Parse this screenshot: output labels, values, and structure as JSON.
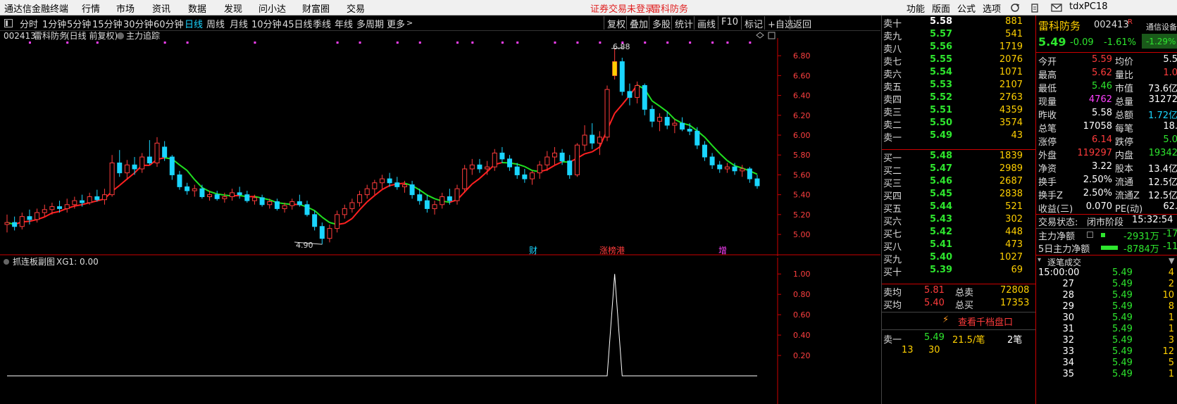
{
  "menubar": {
    "app_title": "通达信金融终端",
    "items": [
      "行情",
      "市场",
      "资讯",
      "数据",
      "发现",
      "问小达",
      "财富圈",
      "交易"
    ],
    "warning": "证券交易未登录",
    "stock_link": "雷科防务",
    "right_items": [
      "功能",
      "版面",
      "公式",
      "选项"
    ],
    "user": "tdxPC18"
  },
  "toolbar": {
    "periods": [
      "分时",
      "1分钟",
      "5分钟",
      "15分钟",
      "30分钟",
      "60分钟",
      "日线",
      "周线",
      "月线",
      "10分钟",
      "45日线",
      "季线",
      "年线",
      "多周期",
      "更多"
    ],
    "active_period": "日线",
    "right_buttons": [
      "复权",
      "叠加",
      "多股",
      "统计",
      "画线",
      "F10",
      "标记",
      "+自选",
      "返回"
    ]
  },
  "main_chart": {
    "header_code": "002413",
    "header_name": "雷科防务",
    "header_mode": "(日线 前复权)",
    "indicator": "主力追踪",
    "high_label": "6.88",
    "low_label": "4.90",
    "y_ticks": [
      "6.80",
      "6.60",
      "6.40",
      "6.20",
      "6.00",
      "5.80",
      "5.60",
      "5.40",
      "5.20",
      "5.00"
    ],
    "event_markers": [
      "财",
      "涨榜港",
      "增"
    ]
  },
  "sub_chart": {
    "title": "抓连板副图",
    "value_label": "XG1: 0.00",
    "y_ticks": [
      "1.00",
      "0.80",
      "0.60",
      "0.40",
      "0.20"
    ]
  },
  "chart_data": {
    "type": "candlestick",
    "title": "002413 雷科防务 (日线 前复权)",
    "ylim": [
      4.88,
      6.95
    ],
    "candles": [
      {
        "o": 5.1,
        "h": 5.2,
        "l": 5.02,
        "c": 5.12
      },
      {
        "o": 5.12,
        "h": 5.18,
        "l": 5.04,
        "c": 5.08
      },
      {
        "o": 5.08,
        "h": 5.22,
        "l": 5.05,
        "c": 5.18
      },
      {
        "o": 5.18,
        "h": 5.25,
        "l": 5.1,
        "c": 5.15
      },
      {
        "o": 5.15,
        "h": 5.26,
        "l": 5.12,
        "c": 5.22
      },
      {
        "o": 5.22,
        "h": 5.3,
        "l": 5.18,
        "c": 5.25
      },
      {
        "o": 5.25,
        "h": 5.32,
        "l": 5.2,
        "c": 5.28
      },
      {
        "o": 5.28,
        "h": 5.34,
        "l": 5.22,
        "c": 5.26
      },
      {
        "o": 5.26,
        "h": 5.36,
        "l": 5.22,
        "c": 5.3
      },
      {
        "o": 5.3,
        "h": 5.38,
        "l": 5.26,
        "c": 5.34
      },
      {
        "o": 5.34,
        "h": 5.4,
        "l": 5.28,
        "c": 5.32
      },
      {
        "o": 5.32,
        "h": 5.42,
        "l": 5.3,
        "c": 5.38
      },
      {
        "o": 5.38,
        "h": 5.45,
        "l": 5.33,
        "c": 5.35
      },
      {
        "o": 5.35,
        "h": 5.46,
        "l": 5.3,
        "c": 5.4
      },
      {
        "o": 5.4,
        "h": 5.8,
        "l": 5.38,
        "c": 5.72
      },
      {
        "o": 5.72,
        "h": 5.85,
        "l": 5.58,
        "c": 5.62
      },
      {
        "o": 5.62,
        "h": 5.75,
        "l": 5.55,
        "c": 5.7
      },
      {
        "o": 5.7,
        "h": 5.78,
        "l": 5.6,
        "c": 5.66
      },
      {
        "o": 5.66,
        "h": 5.82,
        "l": 5.62,
        "c": 5.78
      },
      {
        "o": 5.78,
        "h": 5.95,
        "l": 5.7,
        "c": 5.72
      },
      {
        "o": 5.72,
        "h": 5.98,
        "l": 5.68,
        "c": 5.92
      },
      {
        "o": 5.88,
        "h": 5.94,
        "l": 5.74,
        "c": 5.78
      },
      {
        "o": 5.78,
        "h": 5.8,
        "l": 5.55,
        "c": 5.6
      },
      {
        "o": 5.6,
        "h": 5.64,
        "l": 5.45,
        "c": 5.48
      },
      {
        "o": 5.48,
        "h": 5.52,
        "l": 5.4,
        "c": 5.44
      },
      {
        "o": 5.44,
        "h": 5.5,
        "l": 5.38,
        "c": 5.46
      },
      {
        "o": 5.46,
        "h": 5.5,
        "l": 5.36,
        "c": 5.38
      },
      {
        "o": 5.38,
        "h": 5.44,
        "l": 5.34,
        "c": 5.4
      },
      {
        "o": 5.4,
        "h": 5.44,
        "l": 5.34,
        "c": 5.36
      },
      {
        "o": 5.36,
        "h": 5.42,
        "l": 5.32,
        "c": 5.38
      },
      {
        "o": 5.38,
        "h": 5.46,
        "l": 5.34,
        "c": 5.42
      },
      {
        "o": 5.42,
        "h": 5.48,
        "l": 5.36,
        "c": 5.4
      },
      {
        "o": 5.4,
        "h": 5.44,
        "l": 5.32,
        "c": 5.34
      },
      {
        "o": 5.34,
        "h": 5.4,
        "l": 5.3,
        "c": 5.37
      },
      {
        "o": 5.37,
        "h": 5.4,
        "l": 5.28,
        "c": 5.3
      },
      {
        "o": 5.3,
        "h": 5.36,
        "l": 5.26,
        "c": 5.33
      },
      {
        "o": 5.33,
        "h": 5.36,
        "l": 5.24,
        "c": 5.26
      },
      {
        "o": 5.26,
        "h": 5.32,
        "l": 5.22,
        "c": 5.29
      },
      {
        "o": 5.29,
        "h": 5.36,
        "l": 5.25,
        "c": 5.33
      },
      {
        "o": 5.33,
        "h": 5.4,
        "l": 5.28,
        "c": 5.3
      },
      {
        "o": 5.3,
        "h": 5.34,
        "l": 5.18,
        "c": 5.2
      },
      {
        "o": 5.2,
        "h": 5.24,
        "l": 5.04,
        "c": 5.08
      },
      {
        "o": 5.08,
        "h": 5.12,
        "l": 4.9,
        "c": 4.96
      },
      {
        "o": 4.96,
        "h": 5.1,
        "l": 4.92,
        "c": 5.06
      },
      {
        "o": 5.06,
        "h": 5.24,
        "l": 5.02,
        "c": 5.2
      },
      {
        "o": 5.2,
        "h": 5.3,
        "l": 5.16,
        "c": 5.26
      },
      {
        "o": 5.26,
        "h": 5.36,
        "l": 5.22,
        "c": 5.32
      },
      {
        "o": 5.32,
        "h": 5.44,
        "l": 5.28,
        "c": 5.4
      },
      {
        "o": 5.4,
        "h": 5.5,
        "l": 5.36,
        "c": 5.46
      },
      {
        "o": 5.46,
        "h": 5.55,
        "l": 5.4,
        "c": 5.52
      },
      {
        "o": 5.52,
        "h": 5.6,
        "l": 5.46,
        "c": 5.56
      },
      {
        "o": 5.56,
        "h": 5.62,
        "l": 5.48,
        "c": 5.52
      },
      {
        "o": 5.52,
        "h": 5.58,
        "l": 5.45,
        "c": 5.48
      },
      {
        "o": 5.48,
        "h": 5.54,
        "l": 5.42,
        "c": 5.5
      },
      {
        "o": 5.5,
        "h": 5.54,
        "l": 5.36,
        "c": 5.4
      },
      {
        "o": 5.4,
        "h": 5.46,
        "l": 5.3,
        "c": 5.34
      },
      {
        "o": 5.34,
        "h": 5.4,
        "l": 5.22,
        "c": 5.26
      },
      {
        "o": 5.26,
        "h": 5.34,
        "l": 5.2,
        "c": 5.3
      },
      {
        "o": 5.3,
        "h": 5.42,
        "l": 5.26,
        "c": 5.38
      },
      {
        "o": 5.38,
        "h": 5.46,
        "l": 5.3,
        "c": 5.34
      },
      {
        "o": 5.34,
        "h": 5.5,
        "l": 5.3,
        "c": 5.46
      },
      {
        "o": 5.46,
        "h": 5.7,
        "l": 5.42,
        "c": 5.66
      },
      {
        "o": 5.66,
        "h": 5.76,
        "l": 5.6,
        "c": 5.7
      },
      {
        "o": 5.7,
        "h": 5.76,
        "l": 5.62,
        "c": 5.66
      },
      {
        "o": 5.66,
        "h": 5.74,
        "l": 5.6,
        "c": 5.68
      },
      {
        "o": 5.68,
        "h": 5.86,
        "l": 5.64,
        "c": 5.82
      },
      {
        "o": 5.82,
        "h": 5.88,
        "l": 5.72,
        "c": 5.76
      },
      {
        "o": 5.76,
        "h": 5.8,
        "l": 5.64,
        "c": 5.68
      },
      {
        "o": 5.68,
        "h": 5.72,
        "l": 5.56,
        "c": 5.6
      },
      {
        "o": 5.6,
        "h": 5.66,
        "l": 5.52,
        "c": 5.56
      },
      {
        "o": 5.56,
        "h": 5.64,
        "l": 5.5,
        "c": 5.62
      },
      {
        "o": 5.62,
        "h": 5.74,
        "l": 5.56,
        "c": 5.7
      },
      {
        "o": 5.7,
        "h": 5.84,
        "l": 5.64,
        "c": 5.78
      },
      {
        "o": 5.78,
        "h": 5.88,
        "l": 5.7,
        "c": 5.82
      },
      {
        "o": 5.82,
        "h": 5.86,
        "l": 5.7,
        "c": 5.74
      },
      {
        "o": 5.74,
        "h": 5.8,
        "l": 5.56,
        "c": 5.6
      },
      {
        "o": 5.6,
        "h": 5.92,
        "l": 5.58,
        "c": 5.9
      },
      {
        "o": 5.9,
        "h": 6.1,
        "l": 5.84,
        "c": 6.0
      },
      {
        "o": 6.0,
        "h": 6.12,
        "l": 5.86,
        "c": 5.92
      },
      {
        "o": 5.92,
        "h": 6.04,
        "l": 5.8,
        "c": 5.98
      },
      {
        "o": 5.98,
        "h": 6.5,
        "l": 5.94,
        "c": 6.46
      },
      {
        "o": 6.6,
        "h": 6.88,
        "l": 6.56,
        "c": 6.74
      },
      {
        "o": 6.74,
        "h": 6.78,
        "l": 6.4,
        "c": 6.44
      },
      {
        "o": 6.44,
        "h": 6.52,
        "l": 6.3,
        "c": 6.38
      },
      {
        "o": 6.38,
        "h": 6.54,
        "l": 6.32,
        "c": 6.5
      },
      {
        "o": 6.5,
        "h": 6.52,
        "l": 6.2,
        "c": 6.26
      },
      {
        "o": 6.26,
        "h": 6.3,
        "l": 6.08,
        "c": 6.14
      },
      {
        "o": 6.14,
        "h": 6.22,
        "l": 6.04,
        "c": 6.18
      },
      {
        "o": 6.18,
        "h": 6.24,
        "l": 6.06,
        "c": 6.1
      },
      {
        "o": 6.1,
        "h": 6.16,
        "l": 6.02,
        "c": 6.12
      },
      {
        "o": 6.12,
        "h": 6.18,
        "l": 6.04,
        "c": 6.06
      },
      {
        "o": 6.06,
        "h": 6.12,
        "l": 6.0,
        "c": 6.04
      },
      {
        "o": 6.04,
        "h": 6.08,
        "l": 5.86,
        "c": 5.9
      },
      {
        "o": 5.9,
        "h": 5.94,
        "l": 5.74,
        "c": 5.78
      },
      {
        "o": 5.78,
        "h": 5.82,
        "l": 5.66,
        "c": 5.7
      },
      {
        "o": 5.7,
        "h": 5.74,
        "l": 5.62,
        "c": 5.66
      },
      {
        "o": 5.66,
        "h": 5.72,
        "l": 5.62,
        "c": 5.68
      },
      {
        "o": 5.68,
        "h": 5.72,
        "l": 5.6,
        "c": 5.64
      },
      {
        "o": 5.64,
        "h": 5.7,
        "l": 5.58,
        "c": 5.66
      },
      {
        "o": 5.66,
        "h": 5.68,
        "l": 5.52,
        "c": 5.56
      },
      {
        "o": 5.56,
        "h": 5.6,
        "l": 5.46,
        "c": 5.49
      }
    ],
    "sub_series": {
      "name": "XG1",
      "ylim": [
        0,
        1.05
      ],
      "spike_index": 81,
      "spike_value": 1.0
    }
  },
  "orderbook": {
    "sell": [
      {
        "label": "卖十",
        "price": "5.58",
        "vol": "881"
      },
      {
        "label": "卖九",
        "price": "5.57",
        "vol": "541"
      },
      {
        "label": "卖八",
        "price": "5.56",
        "vol": "1719"
      },
      {
        "label": "卖七",
        "price": "5.55",
        "vol": "2076"
      },
      {
        "label": "卖六",
        "price": "5.54",
        "vol": "1071"
      },
      {
        "label": "卖五",
        "price": "5.53",
        "vol": "2107"
      },
      {
        "label": "卖四",
        "price": "5.52",
        "vol": "2763"
      },
      {
        "label": "卖三",
        "price": "5.51",
        "vol": "4359"
      },
      {
        "label": "卖二",
        "price": "5.50",
        "vol": "3574"
      },
      {
        "label": "卖一",
        "price": "5.49",
        "vol": "43"
      }
    ],
    "buy": [
      {
        "label": "买一",
        "price": "5.48",
        "vol": "1839"
      },
      {
        "label": "买二",
        "price": "5.47",
        "vol": "2989"
      },
      {
        "label": "买三",
        "price": "5.46",
        "vol": "2687"
      },
      {
        "label": "买四",
        "price": "5.45",
        "vol": "2838"
      },
      {
        "label": "买五",
        "price": "5.44",
        "vol": "521"
      },
      {
        "label": "买六",
        "price": "5.43",
        "vol": "302"
      },
      {
        "label": "买七",
        "price": "5.42",
        "vol": "448"
      },
      {
        "label": "买八",
        "price": "5.41",
        "vol": "473"
      },
      {
        "label": "买九",
        "price": "5.40",
        "vol": "1027"
      },
      {
        "label": "买十",
        "price": "5.39",
        "vol": "69"
      }
    ],
    "sell_avg_label": "卖均",
    "sell_avg": "5.81",
    "total_sell_label": "总卖",
    "total_sell": "72808",
    "buy_avg_label": "买均",
    "buy_avg": "5.40",
    "total_buy_label": "总买",
    "total_buy": "17353",
    "depth_link": "查看千档盘口",
    "queue_label": "卖一",
    "queue_price": "5.49",
    "queue_avg": "21.5/笔",
    "queue_count": "2笔",
    "queue_orders": [
      "13",
      "30"
    ]
  },
  "quote": {
    "name": "雷科防务",
    "code": "002413",
    "flag": "R",
    "price": "5.49",
    "change": "-0.09",
    "pct": "-1.61%",
    "group_label": "通信设备",
    "group_pct": "-1.29%",
    "stats": [
      [
        "今开",
        "5.59",
        "up",
        "均价",
        "5.5",
        ""
      ],
      [
        "最高",
        "5.62",
        "up",
        "量比",
        "1.0",
        "up"
      ],
      [
        "最低",
        "5.46",
        "dn",
        "市值",
        "73.6亿",
        ""
      ],
      [
        "现量",
        "4762",
        "mg",
        "总量",
        "31272",
        ""
      ],
      [
        "昨收",
        "5.58",
        "",
        "总额",
        "1.72亿",
        "cy"
      ],
      [
        "总笔",
        "17058",
        "",
        "每笔",
        "18.",
        ""
      ],
      [
        "涨停",
        "6.14",
        "up",
        "跌停",
        "5.0",
        "dn"
      ],
      [
        "外盘",
        "119297",
        "up",
        "内盘",
        "19342",
        "dn"
      ],
      [
        "净资",
        "3.22",
        "",
        "股本",
        "13.4亿",
        ""
      ],
      [
        "换手",
        "2.50%",
        "",
        "流通",
        "12.5亿",
        ""
      ],
      [
        "换手Z",
        "2.50%",
        "",
        "流通Z",
        "12.5亿",
        ""
      ],
      [
        "收益(三)",
        "0.070",
        "",
        "PE(动)",
        "62.",
        ""
      ]
    ],
    "trade_status_label": "交易状态:",
    "trade_status": "闭市阶段",
    "trade_time": "15:32:54",
    "main_flow_label": "主力净额",
    "main_flow": "-2931万",
    "main_flow_pct": "-17",
    "main_flow5_label": "5日主力净额",
    "main_flow5": "-8784万",
    "main_flow5_pct": "-11"
  },
  "ticks": {
    "title": "逐笔成交",
    "rows": [
      {
        "t": "15:00:00",
        "p": "5.49",
        "v": "4"
      },
      {
        "t": "27",
        "p": "5.49",
        "v": "2"
      },
      {
        "t": "28",
        "p": "5.49",
        "v": "10"
      },
      {
        "t": "29",
        "p": "5.49",
        "v": "8"
      },
      {
        "t": "30",
        "p": "5.49",
        "v": "1"
      },
      {
        "t": "31",
        "p": "5.49",
        "v": "1"
      },
      {
        "t": "32",
        "p": "5.49",
        "v": "3"
      },
      {
        "t": "33",
        "p": "5.49",
        "v": "12"
      },
      {
        "t": "34",
        "p": "5.49",
        "v": "5"
      },
      {
        "t": "35",
        "p": "5.49",
        "v": "1"
      }
    ]
  },
  "colors": {
    "up": "#ff3c3c",
    "down": "#2ee62e",
    "cyan": "#1ad5ff",
    "yellow": "#ffd000",
    "magenta": "#ff40ff",
    "ma_up": "#ff2020",
    "ma_down": "#20e020"
  }
}
